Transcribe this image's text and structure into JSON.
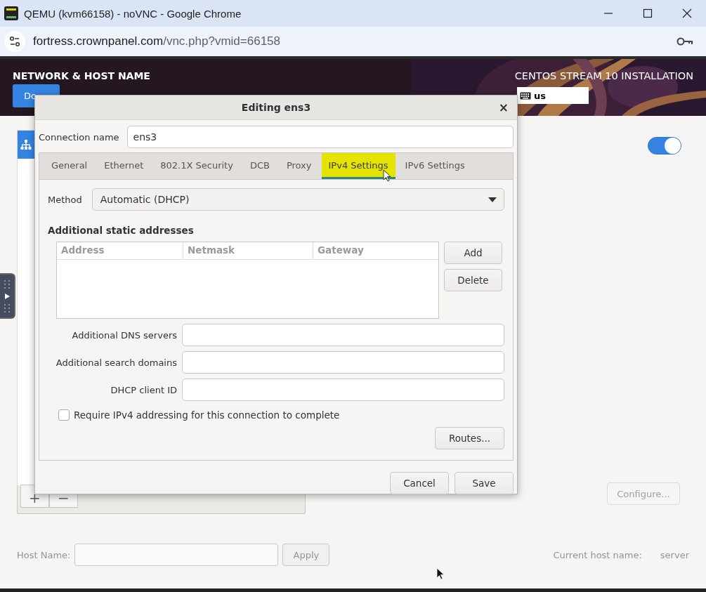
{
  "browser": {
    "title": "QEMU (kvm66158) - noVNC - Google Chrome",
    "url_host": "fortress.crownpanel.com",
    "url_path": "/vnc.php?vmid=66158"
  },
  "installer": {
    "title": "NETWORK & HOST NAME",
    "done_button": "Do",
    "product": "CENTOS STREAM 10 INSTALLATION",
    "keyboard_layout": "us",
    "device_switch_on": true,
    "list_buttons": [
      "+",
      "−"
    ],
    "configure_button": "Configure...",
    "host_name_label": "Host Name:",
    "apply_button": "Apply",
    "current_host_label": "Current host name:",
    "current_host": "server"
  },
  "dialog": {
    "title": "Editing ens3",
    "close": "×",
    "connection_name_label": "Connection name",
    "connection_name": "ens3",
    "tabs": [
      {
        "label": "General",
        "selected": false
      },
      {
        "label": "Ethernet",
        "selected": false
      },
      {
        "label": "802.1X Security",
        "selected": false
      },
      {
        "label": "DCB",
        "selected": false
      },
      {
        "label": "Proxy",
        "selected": false
      },
      {
        "label": "IPv4 Settings",
        "selected": true
      },
      {
        "label": "IPv6 Settings",
        "selected": false
      }
    ],
    "method_label": "Method",
    "method": "Automatic (DHCP)",
    "section_title": "Additional static addresses",
    "columns": [
      "Address",
      "Netmask",
      "Gateway"
    ],
    "add_button": "Add",
    "delete_button": "Delete",
    "fields": [
      {
        "label": "Additional DNS servers"
      },
      {
        "label": "Additional search domains"
      },
      {
        "label": "DHCP client ID"
      }
    ],
    "require_checkbox": {
      "label": "Require IPv4 addressing for this connection to complete",
      "checked": false
    },
    "routes_button": "Routes...",
    "cancel_button": "Cancel",
    "save_button": "Save"
  }
}
